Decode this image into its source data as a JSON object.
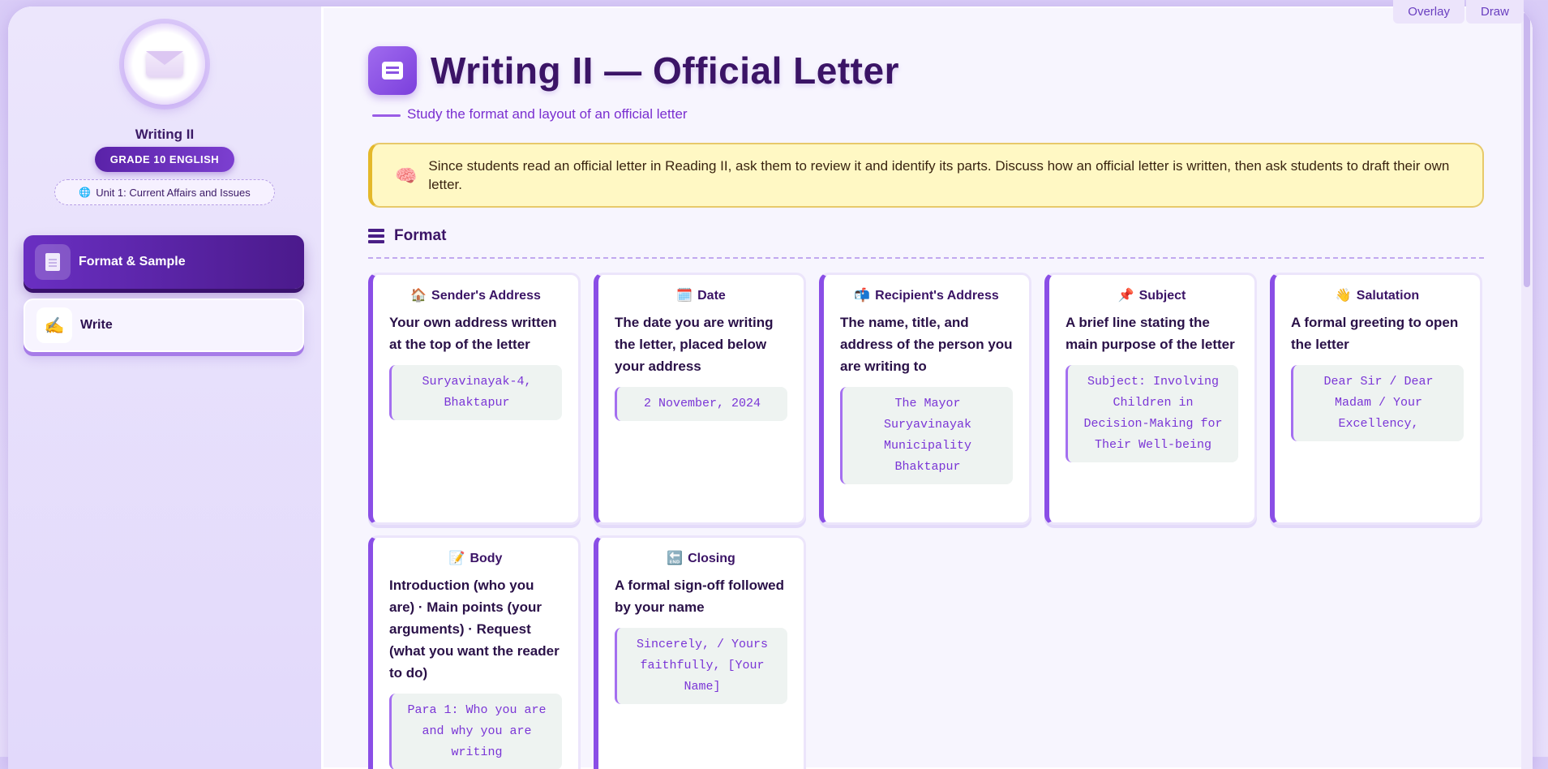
{
  "window": {
    "tabs": [
      "Overlay",
      "Draw"
    ]
  },
  "sidebar": {
    "title": "Writing II",
    "grade": "GRADE 10 ENGLISH",
    "unit": "Unit 1: Current Affairs and Issues",
    "items": [
      {
        "label": "Format & Sample",
        "active": true,
        "icon": "document-icon"
      },
      {
        "label": "Write",
        "active": false,
        "icon": "writing-hand-icon"
      }
    ]
  },
  "main": {
    "title": "Writing II — Official Letter",
    "subtitle": "Study the format and layout of an official letter",
    "tip": "Since students read an official letter in Reading II, ask them to review it and identify its parts. Discuss how an official letter is written, then ask students to draft their own letter.",
    "section": "Format",
    "cards": [
      {
        "emoji": "🏠",
        "title": "Sender's Address",
        "desc": "Your own address written at the top of the letter",
        "example": "Suryavinayak-4, Bhaktapur"
      },
      {
        "emoji": "🗓️",
        "title": "Date",
        "desc": "The date you are writing the letter, placed below your address",
        "example": "2 November, 2024"
      },
      {
        "emoji": "📬",
        "title": "Recipient's Address",
        "desc": "The name, title, and address of the person you are writing to",
        "example": "The Mayor Suryavinayak Municipality Bhaktapur"
      },
      {
        "emoji": "📌",
        "title": "Subject",
        "desc": "A brief line stating the main purpose of the letter",
        "example": "Subject: Involving Children in Decision-Making for Their Well-being"
      },
      {
        "emoji": "👋",
        "title": "Salutation",
        "desc": "A formal greeting to open the letter",
        "example": "Dear Sir / Dear Madam / Your Excellency,"
      },
      {
        "emoji": "📝",
        "title": "Body",
        "desc": "Introduction (who you are) · Main points (your arguments) · Request (what you want the reader to do)",
        "example": "Para 1: Who you are and why you are writing"
      },
      {
        "emoji": "🔚",
        "title": "Closing",
        "desc": "A formal sign-off followed by your name",
        "example": "Sincerely, / Yours faithfully, [Your Name]"
      }
    ]
  },
  "colors": {
    "accent": "#7c3fd0",
    "title": "#3b1466",
    "tip_bg": "#fff8c4"
  }
}
